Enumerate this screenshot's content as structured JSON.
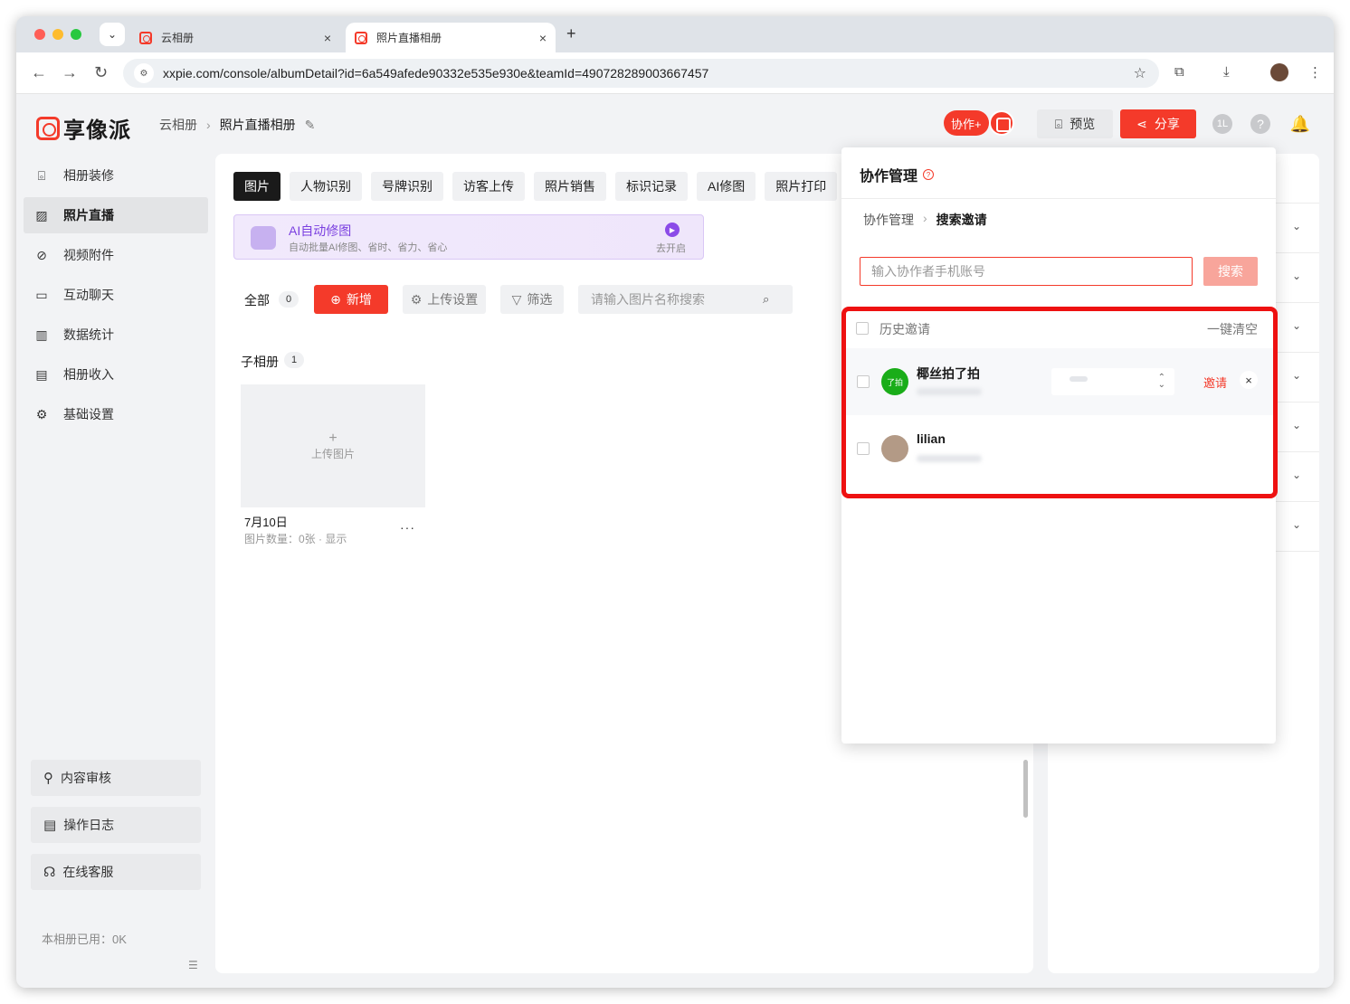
{
  "browser": {
    "tabs": [
      {
        "title": "云相册",
        "close": "×"
      },
      {
        "title": "照片直播相册",
        "close": "×"
      }
    ],
    "new_tab": "+",
    "url": "xxpie.com/console/albumDetail?id=6a549afede90332e535e930e&teamId=490728289003667457"
  },
  "header": {
    "logo_text": "享像派",
    "breadcrumb": [
      "云相册",
      "照片直播相册"
    ],
    "collab_label": "协作+",
    "preview_label": "预览",
    "share_label": "分享",
    "user_initial": "1L"
  },
  "sidebar": {
    "items": [
      {
        "label": "相册装修",
        "icon": "decorate-icon"
      },
      {
        "label": "照片直播",
        "icon": "image-icon"
      },
      {
        "label": "视频附件",
        "icon": "paperclip-icon"
      },
      {
        "label": "互动聊天",
        "icon": "chat-icon"
      },
      {
        "label": "数据统计",
        "icon": "chart-icon"
      },
      {
        "label": "相册收入",
        "icon": "wallet-icon"
      },
      {
        "label": "基础设置",
        "icon": "gear-icon"
      }
    ],
    "bottom": [
      {
        "label": "内容审核",
        "icon": "stamp-icon"
      },
      {
        "label": "操作日志",
        "icon": "log-icon"
      },
      {
        "label": "在线客服",
        "icon": "headset-icon"
      }
    ],
    "storage": "本相册已用：0K"
  },
  "main": {
    "tabs": [
      "图片",
      "人物识别",
      "号牌识别",
      "访客上传",
      "照片销售",
      "标识记录",
      "AI修图",
      "照片打印"
    ],
    "ai_banner": {
      "title": "AI自动修图",
      "subtitle": "自动批量AI修图、省时、省力、省心",
      "action": "去开启"
    },
    "filter": {
      "all_label": "全部",
      "all_count": "0",
      "add_label": "新增",
      "upload_settings_label": "上传设置",
      "filter_label": "筛选",
      "search_placeholder": "请输入图片名称搜索"
    },
    "sub_album": {
      "label": "子相册",
      "count": "1",
      "upload_label": "上传图片",
      "date": "7月10日",
      "meta": "图片数量：0张 · 显示",
      "more": "···"
    }
  },
  "popover": {
    "title": "协作管理",
    "breadcrumb": [
      "协作管理",
      "搜索邀请"
    ],
    "input_placeholder": "输入协作者手机账号",
    "search_label": "搜索",
    "history_label": "历史邀请",
    "clear_label": "一键清空",
    "invites": [
      {
        "name": "椰丝拍了拍",
        "avatar_text": "了拍",
        "avatar_color": "#1aad19",
        "action": "邀请",
        "close": "×"
      },
      {
        "name": "lilian",
        "avatar_text": "",
        "avatar_color": "#b39a86"
      }
    ]
  },
  "colors": {
    "accent": "#f43a2a",
    "highlight_border": "#ee1111",
    "ai_purple": "#7a3fe0"
  }
}
